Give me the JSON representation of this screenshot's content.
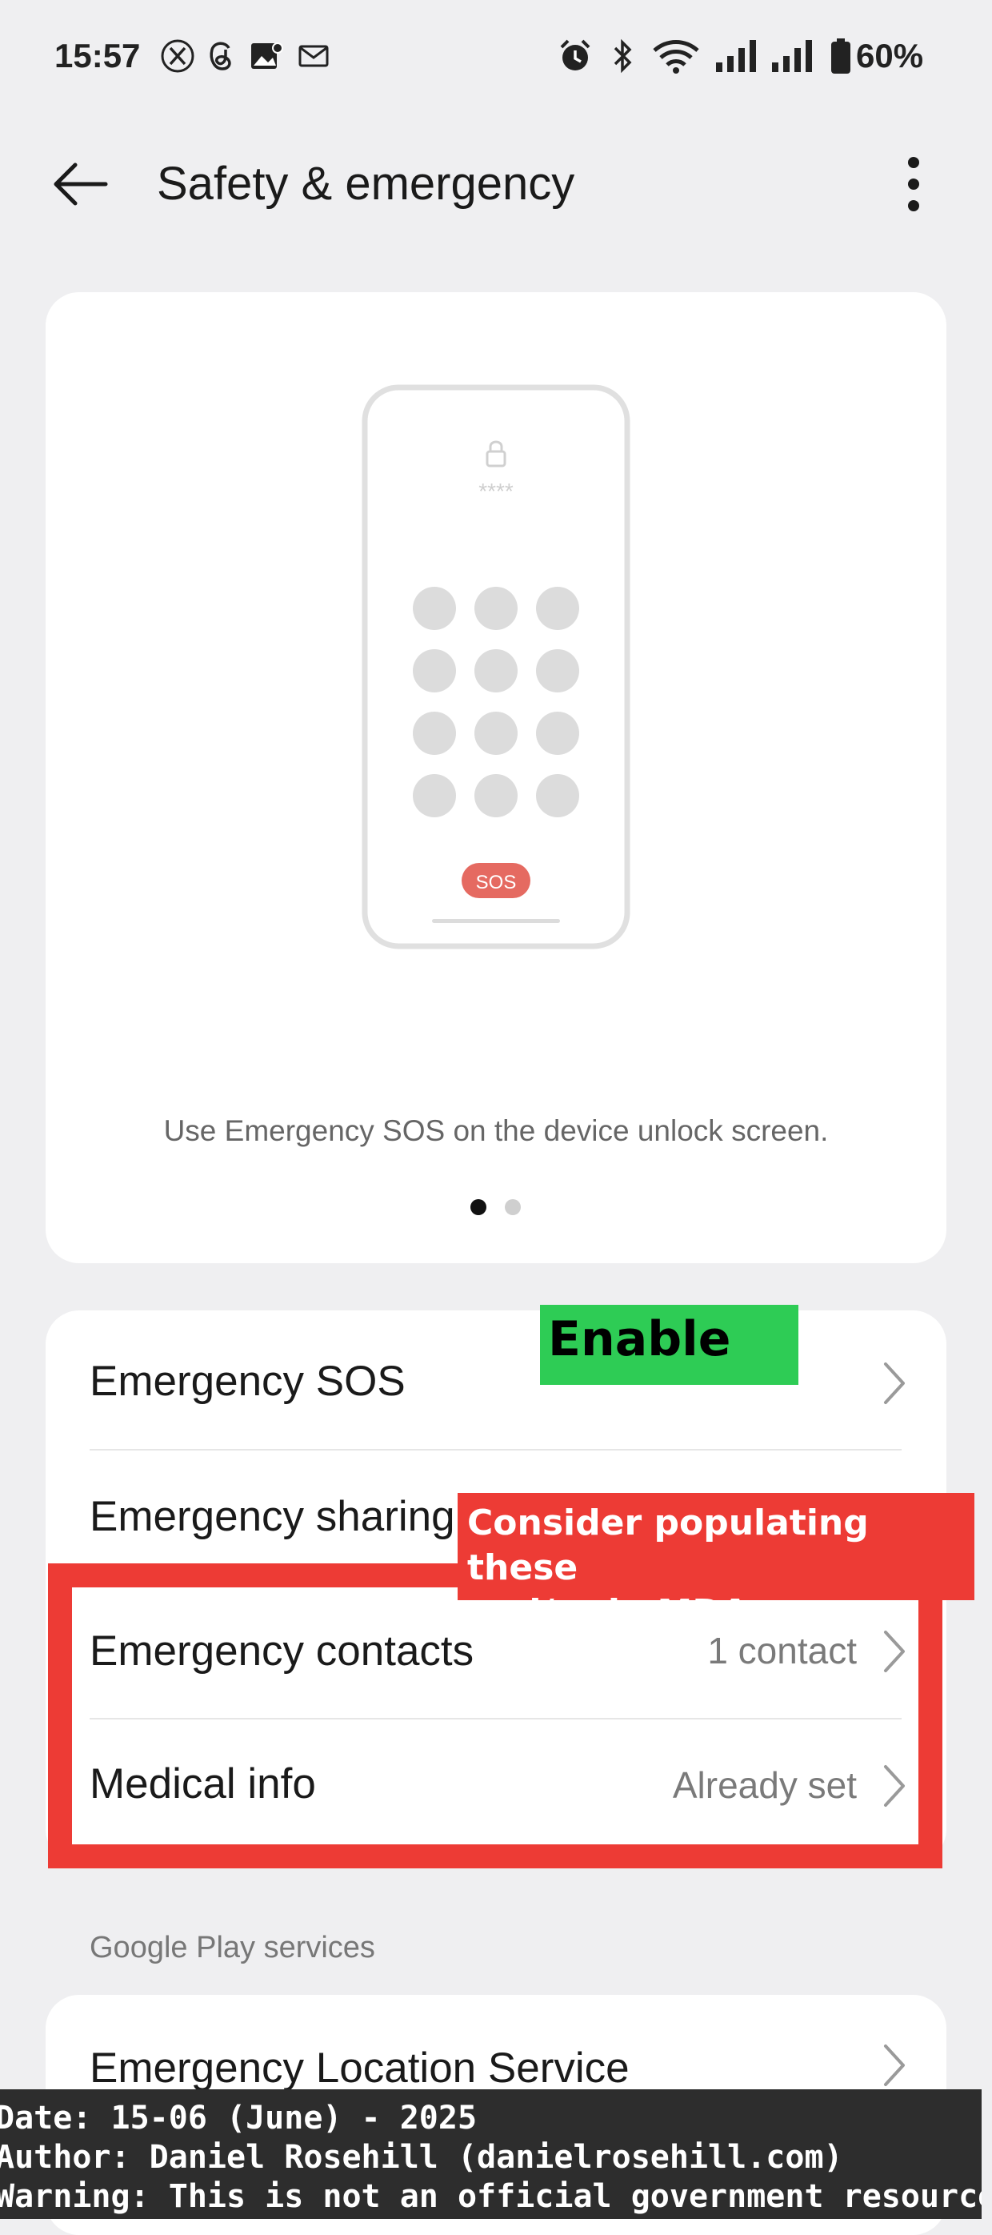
{
  "status_bar": {
    "time": "15:57",
    "notification_icons": [
      "x-icon",
      "threads-icon",
      "photo-icon",
      "mail-icon"
    ],
    "system_icons": [
      "alarm-icon",
      "bluetooth-icon",
      "wifi-icon",
      "signal-icon",
      "signal-icon",
      "battery-icon"
    ],
    "battery": "60%"
  },
  "header": {
    "title": "Safety & emergency",
    "back_icon": "arrow-left-icon",
    "more_icon": "more-vertical-icon"
  },
  "illustration": {
    "lock_stars": "****",
    "sos_label": "SOS",
    "caption": "Use Emergency SOS on the device unlock screen.",
    "page_indicator": {
      "current": 1,
      "total": 2
    }
  },
  "settings": {
    "items": [
      {
        "label": "Emergency SOS",
        "value": ""
      },
      {
        "label": "Emergency sharing",
        "value": ""
      },
      {
        "label": "Emergency contacts",
        "value": "1 contact"
      },
      {
        "label": "Medical info",
        "value": "Already set"
      }
    ]
  },
  "annotations": {
    "enable": "Enable",
    "consider_line1": "Consider populating these",
    "consider_line2": "and/or in MDA app"
  },
  "section": {
    "header": "Google Play services",
    "items": [
      {
        "label": "Emergency Location Service"
      }
    ]
  },
  "footer": {
    "line1": "Date: 15-06 (June) - 2025",
    "line2": "Author: Daniel Rosehill (danielrosehill.com)",
    "line3": "Warning: This is not an official government resource!"
  },
  "colors": {
    "background": "#efeff1",
    "card": "#ffffff",
    "annotation_red": "#ed3b35",
    "annotation_green": "#2ecc55",
    "sos_red": "#e56a61",
    "footer_bg": "#2d2d2d"
  }
}
